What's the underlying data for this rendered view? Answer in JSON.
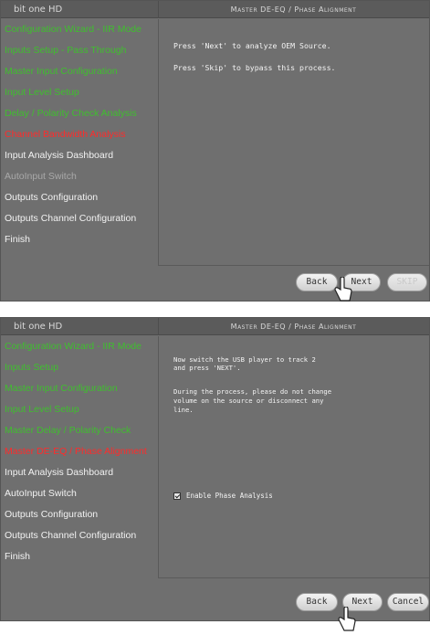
{
  "brand": "bit one HD",
  "title": "Master DE-EQ / Phase Alignment",
  "panel1": {
    "sidebar": [
      {
        "label": "Configuration Wizard - IIR Mode",
        "state": "done"
      },
      {
        "label": "Inputs Setup - Pass Through",
        "state": "done"
      },
      {
        "label": "Master Input Configuration",
        "state": "done"
      },
      {
        "label": "Input Level Setup",
        "state": "done"
      },
      {
        "label": "Delay / Polarity Check Analysis",
        "state": "done"
      },
      {
        "label": "Channel Bandwidth Analysis",
        "state": "current"
      },
      {
        "label": "Input Analysis Dashboard",
        "state": "pending"
      },
      {
        "label": "AutoInput Switch",
        "state": "disabled"
      },
      {
        "label": "Outputs Configuration",
        "state": "pending"
      },
      {
        "label": "Outputs Channel Configuration",
        "state": "pending"
      },
      {
        "label": "Finish",
        "state": "pending"
      }
    ],
    "message_line1": "Press 'Next' to analyze OEM Source.",
    "message_line2": "Press 'Skip' to bypass this process.",
    "buttons": {
      "back": "Back",
      "next": "Next",
      "skip": "SKIP"
    }
  },
  "panel2": {
    "sidebar": [
      {
        "label": "Configuration Wizard - IIR Mode",
        "state": "done"
      },
      {
        "label": "Inputs Setup",
        "state": "done"
      },
      {
        "label": "Master Input Configuration",
        "state": "done"
      },
      {
        "label": "Input Level Setup",
        "state": "done"
      },
      {
        "label": "Master Delay / Polarity Check",
        "state": "done"
      },
      {
        "label": "Master DE-EQ / Phase Alignment",
        "state": "current"
      },
      {
        "label": "Input Analysis Dashboard",
        "state": "pending"
      },
      {
        "label": "AutoInput Switch",
        "state": "pending"
      },
      {
        "label": "Outputs Configuration",
        "state": "pending"
      },
      {
        "label": "Outputs Channel Configuration",
        "state": "pending"
      },
      {
        "label": "Finish",
        "state": "pending"
      }
    ],
    "message_line1": "Now switch the USB player to track 2\nand press 'NEXT'.",
    "message_line2": "During the process, please do not change\nvolume on the source or disconnect any\nline.",
    "checkbox_label": "Enable Phase Analysis",
    "checkbox_checked": true,
    "buttons": {
      "back": "Back",
      "next": "Next",
      "cancel": "Cancel"
    }
  },
  "colors": {
    "done": "#3fbf2e",
    "current": "#ff2b2b",
    "pending": "#f2f2f2",
    "disabled": "#a9a9a9",
    "panel_bg": "#6f6f6f"
  }
}
